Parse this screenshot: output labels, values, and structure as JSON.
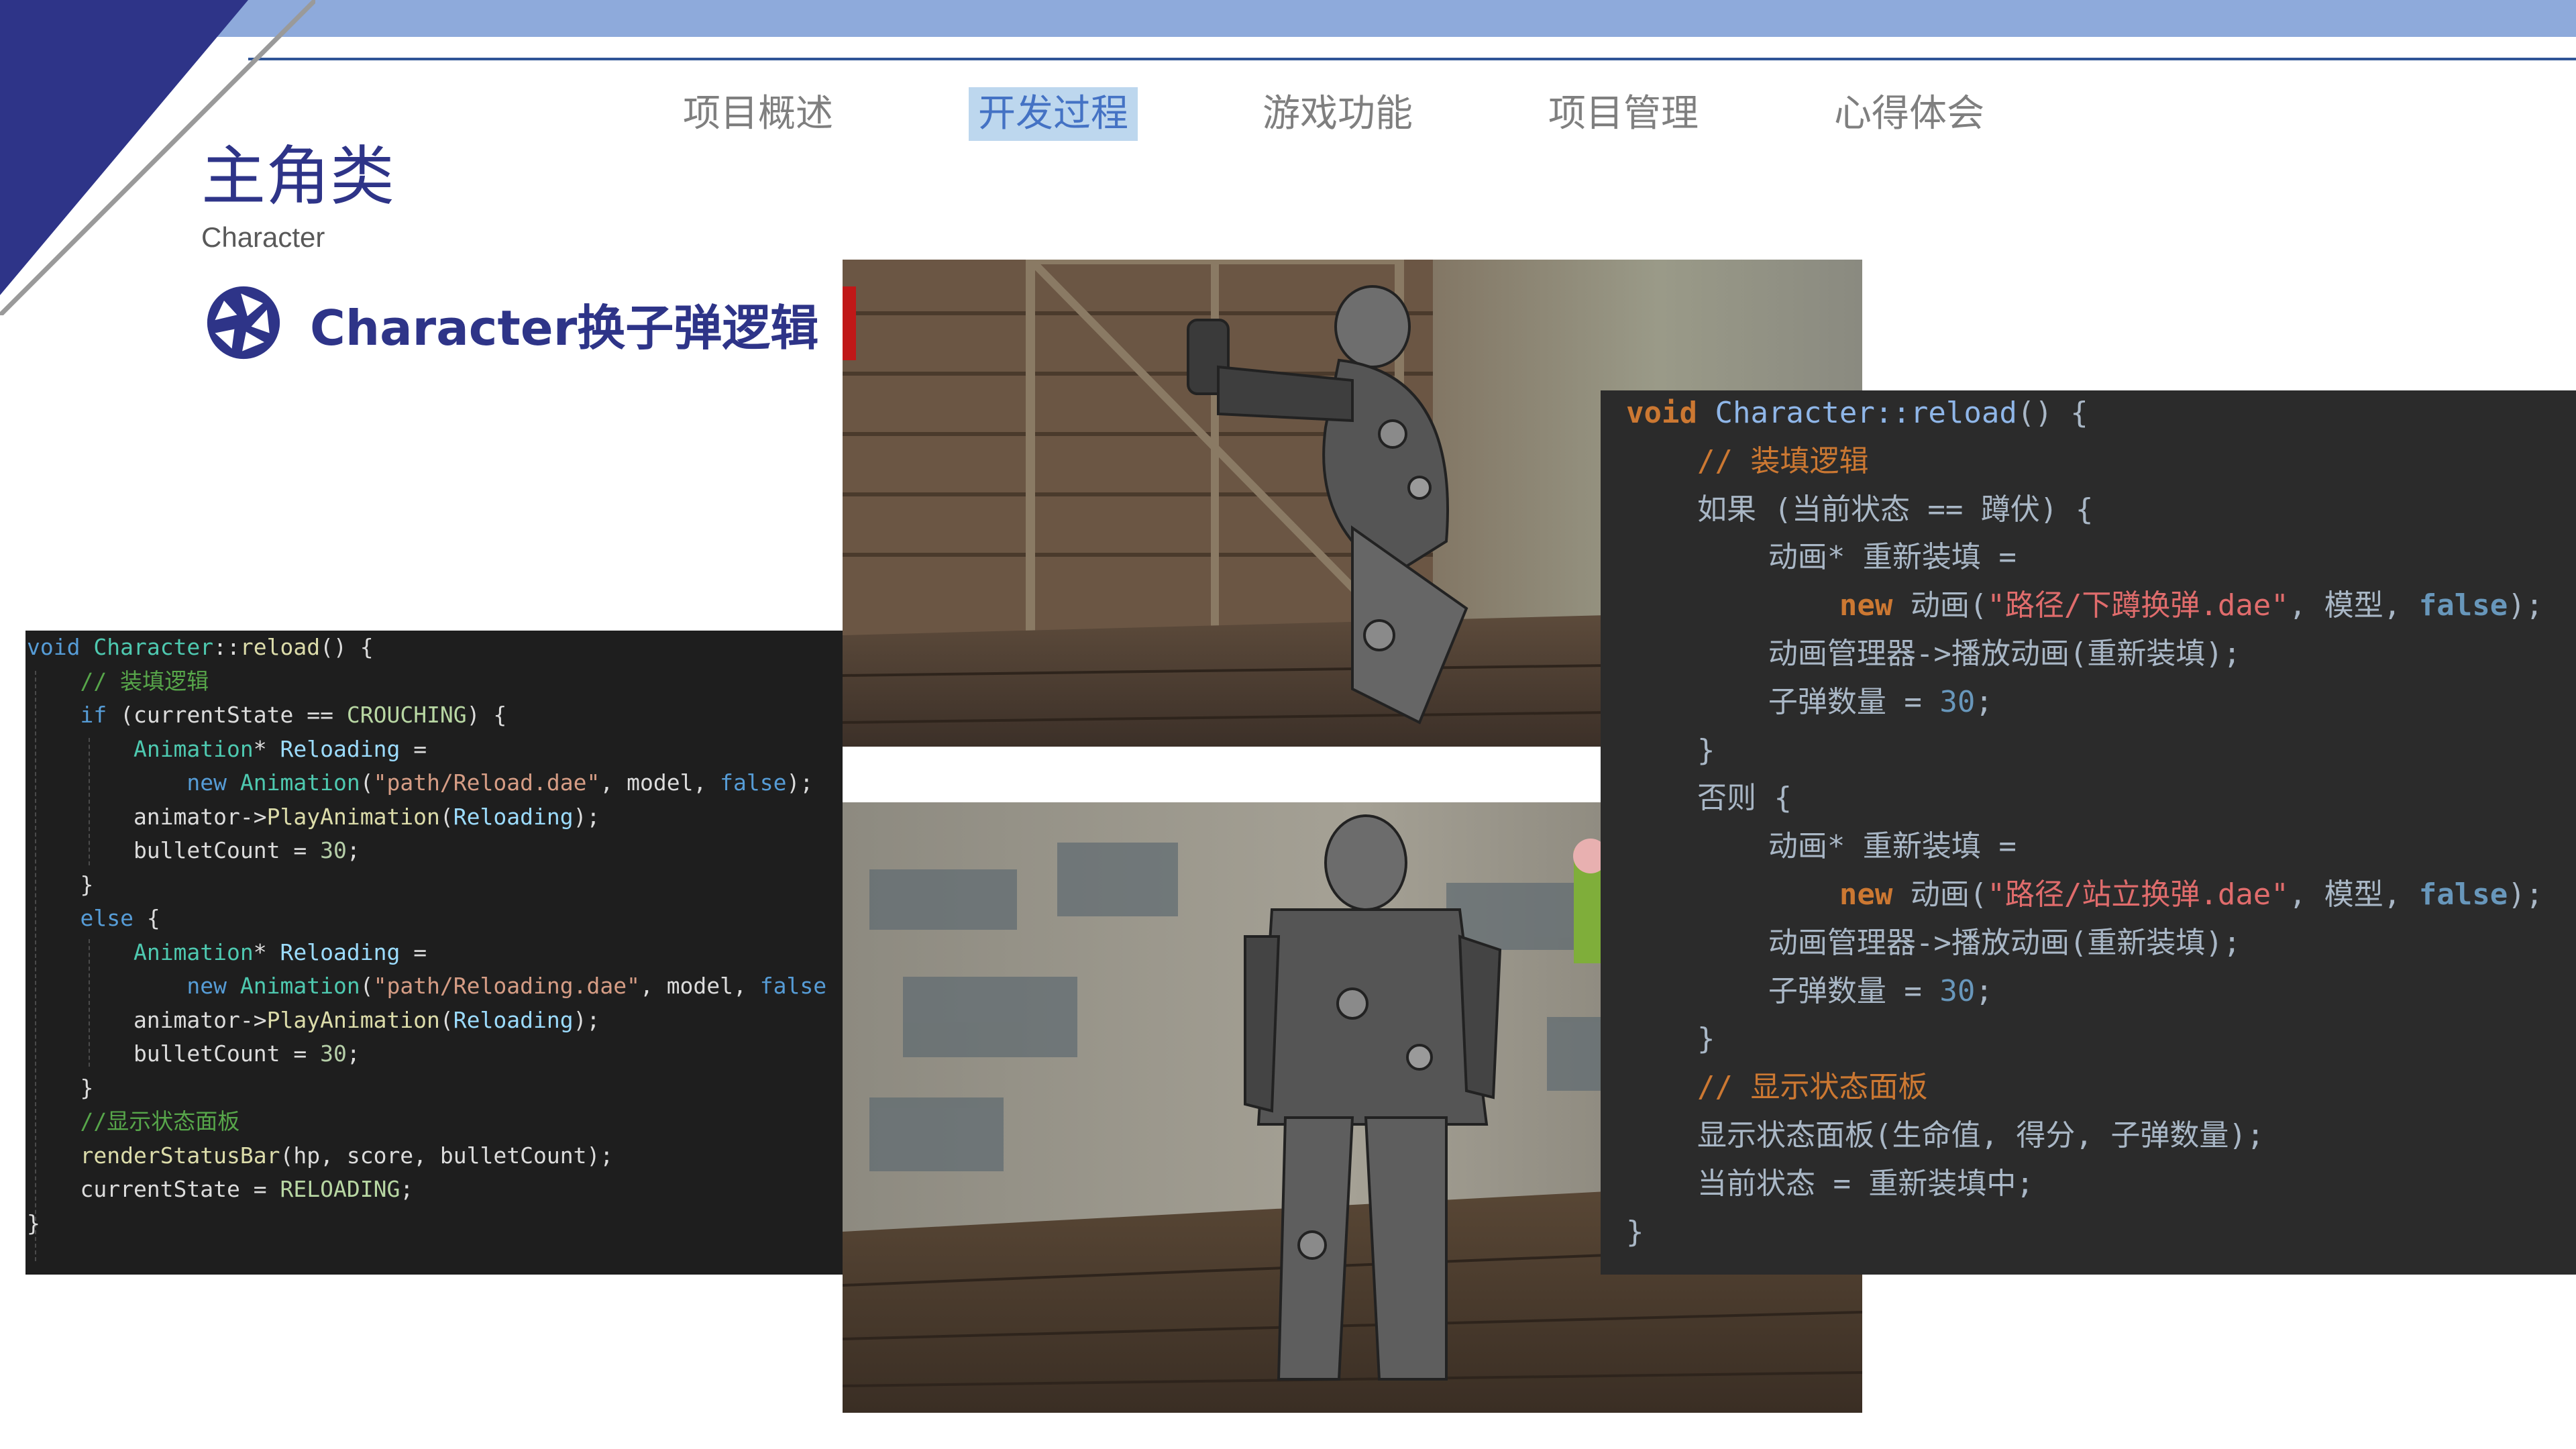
{
  "nav": {
    "tabs": [
      {
        "label": "项目概述",
        "active": false
      },
      {
        "label": "开发过程",
        "active": true
      },
      {
        "label": "游戏功能",
        "active": false
      },
      {
        "label": "项目管理",
        "active": false
      },
      {
        "label": "心得体会",
        "active": false
      }
    ]
  },
  "page": {
    "title": "主角类",
    "subtitle": "Character",
    "section_heading": "Character换子弹逻辑",
    "section_icon": "aperture-icon"
  },
  "colors": {
    "accent_navy": "#2e3488",
    "top_bar": "#8eaadb",
    "active_tab_bg": "#bdd7ee"
  },
  "code_left": {
    "lines": [
      [
        [
          "kw",
          "void"
        ],
        [
          "tx",
          " "
        ],
        [
          "ty",
          "Character"
        ],
        [
          "tx",
          "::"
        ],
        [
          "fn",
          "reload"
        ],
        [
          "tx",
          "() {"
        ]
      ],
      [
        [
          "tx",
          "    "
        ],
        [
          "cm",
          "// 装填逻辑"
        ]
      ],
      [
        [
          "tx",
          "    "
        ],
        [
          "kw",
          "if"
        ],
        [
          "tx",
          " (currentState == "
        ],
        [
          "en",
          "CROUCHING"
        ],
        [
          "tx",
          ") {"
        ]
      ],
      [
        [
          "tx",
          "        "
        ],
        [
          "ty",
          "Animation"
        ],
        [
          "tx",
          "* "
        ],
        [
          "pa",
          "Reloading"
        ],
        [
          "tx",
          " ="
        ]
      ],
      [
        [
          "tx",
          "            "
        ],
        [
          "kw",
          "new"
        ],
        [
          "tx",
          " "
        ],
        [
          "ty",
          "Animation"
        ],
        [
          "tx",
          "("
        ],
        [
          "st",
          "\"path/Reload.dae\""
        ],
        [
          "tx",
          ", model, "
        ],
        [
          "kw",
          "false"
        ],
        [
          "tx",
          ");"
        ]
      ],
      [
        [
          "tx",
          "        animator->"
        ],
        [
          "fn",
          "PlayAnimation"
        ],
        [
          "tx",
          "("
        ],
        [
          "pa",
          "Reloading"
        ],
        [
          "tx",
          ");"
        ]
      ],
      [
        [
          "tx",
          "        bulletCount = "
        ],
        [
          "nu",
          "30"
        ],
        [
          "tx",
          ";"
        ]
      ],
      [
        [
          "tx",
          "    }"
        ]
      ],
      [
        [
          "tx",
          "    "
        ],
        [
          "kw",
          "else"
        ],
        [
          "tx",
          " {"
        ]
      ],
      [
        [
          "tx",
          "        "
        ],
        [
          "ty",
          "Animation"
        ],
        [
          "tx",
          "* "
        ],
        [
          "pa",
          "Reloading"
        ],
        [
          "tx",
          " ="
        ]
      ],
      [
        [
          "tx",
          "            "
        ],
        [
          "kw",
          "new"
        ],
        [
          "tx",
          " "
        ],
        [
          "ty",
          "Animation"
        ],
        [
          "tx",
          "("
        ],
        [
          "st",
          "\"path/Reloading.dae\""
        ],
        [
          "tx",
          ", model, "
        ],
        [
          "kw",
          "false"
        ]
      ],
      [
        [
          "tx",
          "        animator->"
        ],
        [
          "fn",
          "PlayAnimation"
        ],
        [
          "tx",
          "("
        ],
        [
          "pa",
          "Reloading"
        ],
        [
          "tx",
          ");"
        ]
      ],
      [
        [
          "tx",
          "        bulletCount = "
        ],
        [
          "nu",
          "30"
        ],
        [
          "tx",
          ";"
        ]
      ],
      [
        [
          "tx",
          "    }"
        ]
      ],
      [
        [
          "tx",
          "    "
        ],
        [
          "cm",
          "//显示状态面板"
        ]
      ],
      [
        [
          "tx",
          "    "
        ],
        [
          "fn",
          "renderStatusBar"
        ],
        [
          "tx",
          "(hp, score, bulletCount);"
        ]
      ],
      [
        [
          "tx",
          "    currentState = "
        ],
        [
          "en",
          "RELOADING"
        ],
        [
          "tx",
          ";"
        ]
      ],
      [
        [
          "tx",
          "}"
        ]
      ]
    ]
  },
  "code_right": {
    "lines": [
      [
        [
          "kw",
          "void"
        ],
        [
          "tx",
          " "
        ],
        [
          "fnb",
          "Character::reload"
        ],
        [
          "tx",
          "() {"
        ]
      ],
      [
        [
          "tx",
          "    "
        ],
        [
          "cm",
          "// 装填逻辑"
        ]
      ],
      [
        [
          "tx",
          "    如果 (当前状态 == 蹲伏) {"
        ]
      ],
      [
        [
          "tx",
          "        动画* 重新装填 ="
        ]
      ],
      [
        [
          "tx",
          "            "
        ],
        [
          "kw",
          "new"
        ],
        [
          "tx",
          " 动画("
        ],
        [
          "st",
          "\"路径/下蹲换弹.dae\""
        ],
        [
          "tx",
          ", 模型, "
        ],
        [
          "bl",
          "false"
        ],
        [
          "tx",
          ");"
        ]
      ],
      [
        [
          "tx",
          "        动画管理器->播放动画(重新装填);"
        ]
      ],
      [
        [
          "tx",
          "        子弹数量 = "
        ],
        [
          "nu",
          "30"
        ],
        [
          "tx",
          ";"
        ]
      ],
      [
        [
          "tx",
          "    }"
        ]
      ],
      [
        [
          "tx",
          "    否则 {"
        ]
      ],
      [
        [
          "tx",
          "        动画* 重新装填 ="
        ]
      ],
      [
        [
          "tx",
          "            "
        ],
        [
          "kw",
          "new"
        ],
        [
          "tx",
          " 动画("
        ],
        [
          "st",
          "\"路径/站立换弹.dae\""
        ],
        [
          "tx",
          ", 模型, "
        ],
        [
          "bl",
          "false"
        ],
        [
          "tx",
          ");"
        ]
      ],
      [
        [
          "tx",
          "        动画管理器->播放动画(重新装填);"
        ]
      ],
      [
        [
          "tx",
          "        子弹数量 = "
        ],
        [
          "nu",
          "30"
        ],
        [
          "tx",
          ";"
        ]
      ],
      [
        [
          "tx",
          "    }"
        ]
      ],
      [
        [
          "tx",
          "    "
        ],
        [
          "cm",
          "// 显示状态面板"
        ]
      ],
      [
        [
          "tx",
          "    显示状态面板(生命值, 得分, 子弹数量);"
        ]
      ],
      [
        [
          "tx",
          "    当前状态 = 重新装填中;"
        ]
      ],
      [
        [
          "tx",
          "}"
        ]
      ]
    ]
  }
}
